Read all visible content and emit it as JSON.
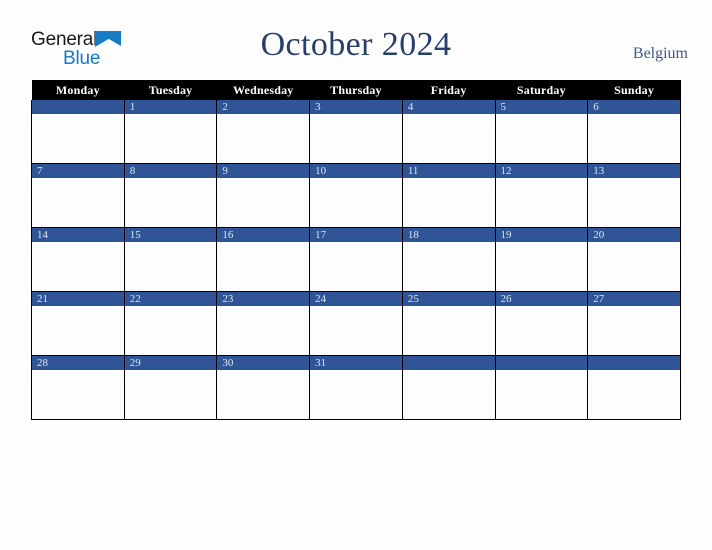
{
  "logo": {
    "line1": "General",
    "line2": "Blue",
    "triangle_icon": "triangle-right-icon",
    "line1_color": "#1a1a1a",
    "line2_color": "#147bc4",
    "triangle_color": "#147bc4"
  },
  "header": {
    "title": "October 2024",
    "country": "Belgium",
    "title_color": "#26406b",
    "country_color": "#3e5a85"
  },
  "calendar": {
    "accent_color": "#2f5597",
    "header_bg": "#000000",
    "header_fg": "#ffffff",
    "daynum_color": "#dfe6f2",
    "weekday_headers": [
      "Monday",
      "Tuesday",
      "Wednesday",
      "Thursday",
      "Friday",
      "Saturday",
      "Sunday"
    ],
    "weeks": [
      [
        {
          "day": ""
        },
        {
          "day": "1"
        },
        {
          "day": "2"
        },
        {
          "day": "3"
        },
        {
          "day": "4"
        },
        {
          "day": "5"
        },
        {
          "day": "6"
        }
      ],
      [
        {
          "day": "7"
        },
        {
          "day": "8"
        },
        {
          "day": "9"
        },
        {
          "day": "10"
        },
        {
          "day": "11"
        },
        {
          "day": "12"
        },
        {
          "day": "13"
        }
      ],
      [
        {
          "day": "14"
        },
        {
          "day": "15"
        },
        {
          "day": "16"
        },
        {
          "day": "17"
        },
        {
          "day": "18"
        },
        {
          "day": "19"
        },
        {
          "day": "20"
        }
      ],
      [
        {
          "day": "21"
        },
        {
          "day": "22"
        },
        {
          "day": "23"
        },
        {
          "day": "24"
        },
        {
          "day": "25"
        },
        {
          "day": "26"
        },
        {
          "day": "27"
        }
      ],
      [
        {
          "day": "28"
        },
        {
          "day": "29"
        },
        {
          "day": "30"
        },
        {
          "day": "31"
        },
        {
          "day": ""
        },
        {
          "day": ""
        },
        {
          "day": ""
        }
      ]
    ]
  }
}
